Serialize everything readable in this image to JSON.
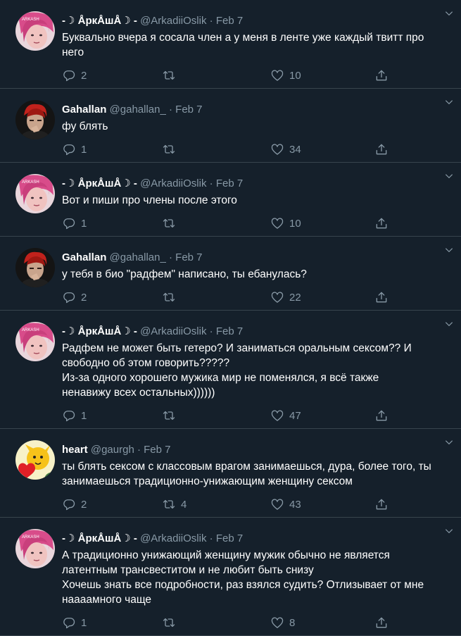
{
  "tweets": [
    {
      "name": "-☽ ÅркÅшÅ☽ -",
      "handle": "@ArkadiiOslik",
      "dot": "·",
      "date": "Feb 7",
      "text": "Буквально вчера я сосала член а у меня в ленте уже каждый твитт про\nнего",
      "replies": "2",
      "retweets": "",
      "likes": "10",
      "avatar": "pink"
    },
    {
      "name": "Gahallan",
      "handle": "@gahallan_",
      "dot": "·",
      "date": "Feb 7",
      "text": "фу блять",
      "replies": "1",
      "retweets": "",
      "likes": "34",
      "avatar": "red"
    },
    {
      "name": "-☽ ÅркÅшÅ☽ -",
      "handle": "@ArkadiiOslik",
      "dot": "·",
      "date": "Feb 7",
      "text": "Вот и пиши про члены после этого",
      "replies": "1",
      "retweets": "",
      "likes": "10",
      "avatar": "pink"
    },
    {
      "name": "Gahallan",
      "handle": "@gahallan_",
      "dot": "·",
      "date": "Feb 7",
      "text": "у тебя в био \"радфем\" написано, ты ебанулась?",
      "replies": "2",
      "retweets": "",
      "likes": "22",
      "avatar": "red"
    },
    {
      "name": "-☽ ÅркÅшÅ☽ -",
      "handle": "@ArkadiiOslik",
      "dot": "·",
      "date": "Feb 7",
      "text": "Радфем не может быть гетеро? И заниматься оральным сексом?? И\nсвободно об этом говорить?????\nИз-за одного хорошего мужика мир не поменялся, я всё также\nненавижу всех остальных))))))",
      "replies": "1",
      "retweets": "",
      "likes": "47",
      "avatar": "pink"
    },
    {
      "name": "heart",
      "handle": "@gaurgh",
      "dot": "·",
      "date": "Feb 7",
      "text": "ты блять сексом с классовым врагом занимаешься, дура, более того, ты\nзанимаешься традиционно-унижающим женщину сексом",
      "replies": "2",
      "retweets": "4",
      "likes": "43",
      "avatar": "yellow"
    },
    {
      "name": "-☽ ÅркÅшÅ☽ -",
      "handle": "@ArkadiiOslik",
      "dot": "·",
      "date": "Feb 7",
      "text": "А традиционно унижающий женщину мужик обычно не является\nлатентным трансвеститом и не любит быть снизу\nХочешь знать все подробности, раз взялся судить? Отлизывает от мне\nнаааамного чаще",
      "replies": "1",
      "retweets": "",
      "likes": "8",
      "avatar": "pink"
    }
  ],
  "icons": {
    "reply": "reply-icon",
    "retweet": "retweet-icon",
    "like": "heart-icon",
    "share": "share-icon",
    "more": "chevron-down-icon"
  },
  "colors": {
    "background": "#15202b",
    "secondary_text": "#8899a6",
    "divider": "#38444d"
  }
}
